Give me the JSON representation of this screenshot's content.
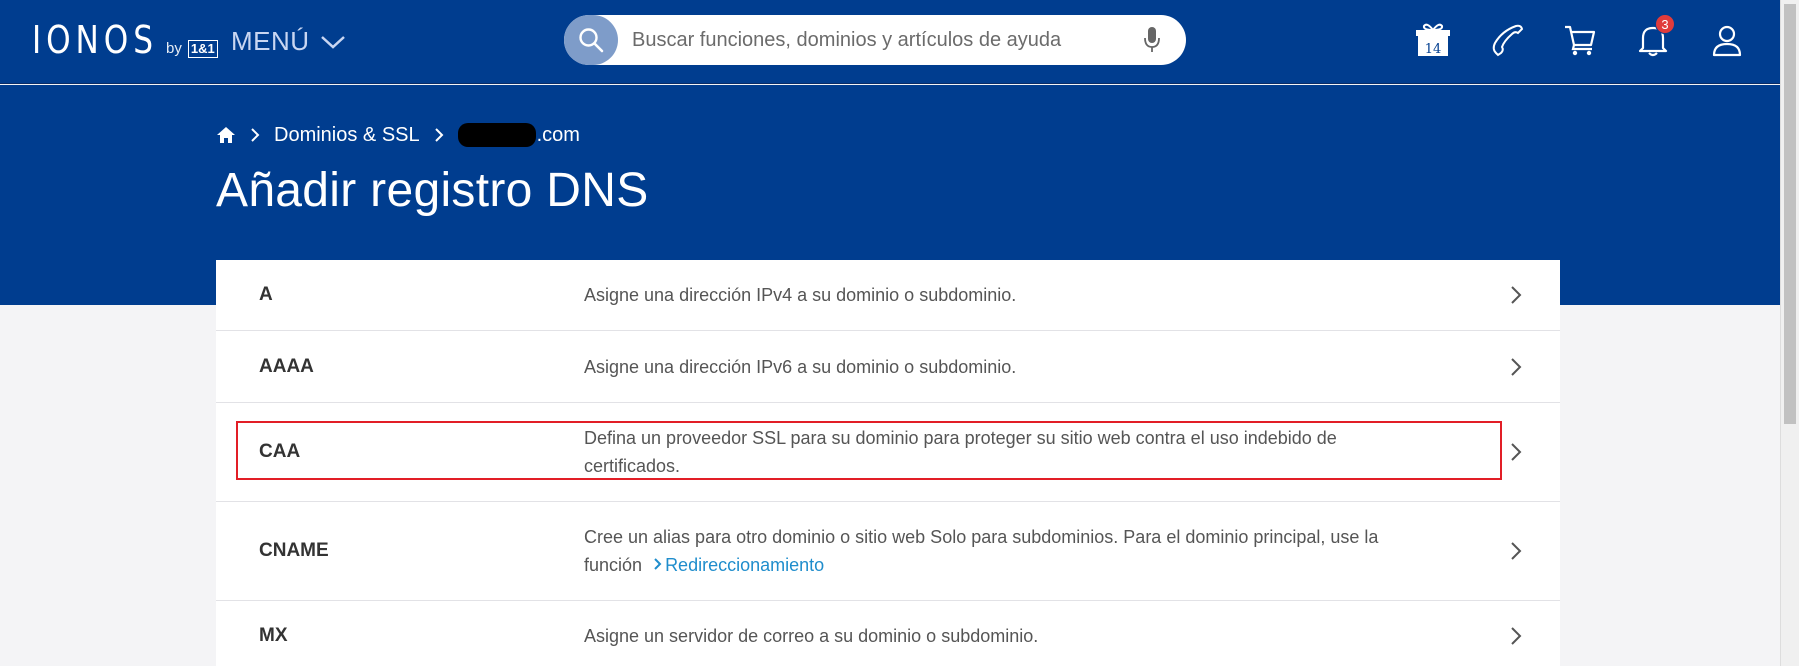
{
  "header": {
    "logo_text": "IONOS",
    "logo_by": "by",
    "logo_badge": "1&1",
    "menu_label": "MENÚ",
    "search_placeholder": "Buscar funciones, dominios y artículos de ayuda",
    "gift_number": "14",
    "notifications_count": "3"
  },
  "breadcrumb": {
    "section": "Dominios & SSL",
    "domain_suffix": ".com"
  },
  "page_title": "Añadir registro DNS",
  "records": [
    {
      "type": "A",
      "description": "Asigne una dirección IPv4 a su dominio o subdominio."
    },
    {
      "type": "AAAA",
      "description": "Asigne una dirección IPv6 a su dominio o subdominio."
    },
    {
      "type": "CAA",
      "description": "Defina un proveedor SSL para su dominio para proteger su sitio web contra el uso indebido de certificados."
    },
    {
      "type": "CNAME",
      "description": "Cree un alias para otro dominio o sitio web Solo para subdominios. Para el dominio principal, use la función",
      "link": "Redireccionamiento"
    },
    {
      "type": "MX",
      "description": "Asigne un servidor de correo a su dominio o subdominio."
    }
  ],
  "colors": {
    "brand": "#003d8f",
    "link": "#1f8dcc",
    "highlight": "#e21e26",
    "badge": "#e03b3b"
  }
}
